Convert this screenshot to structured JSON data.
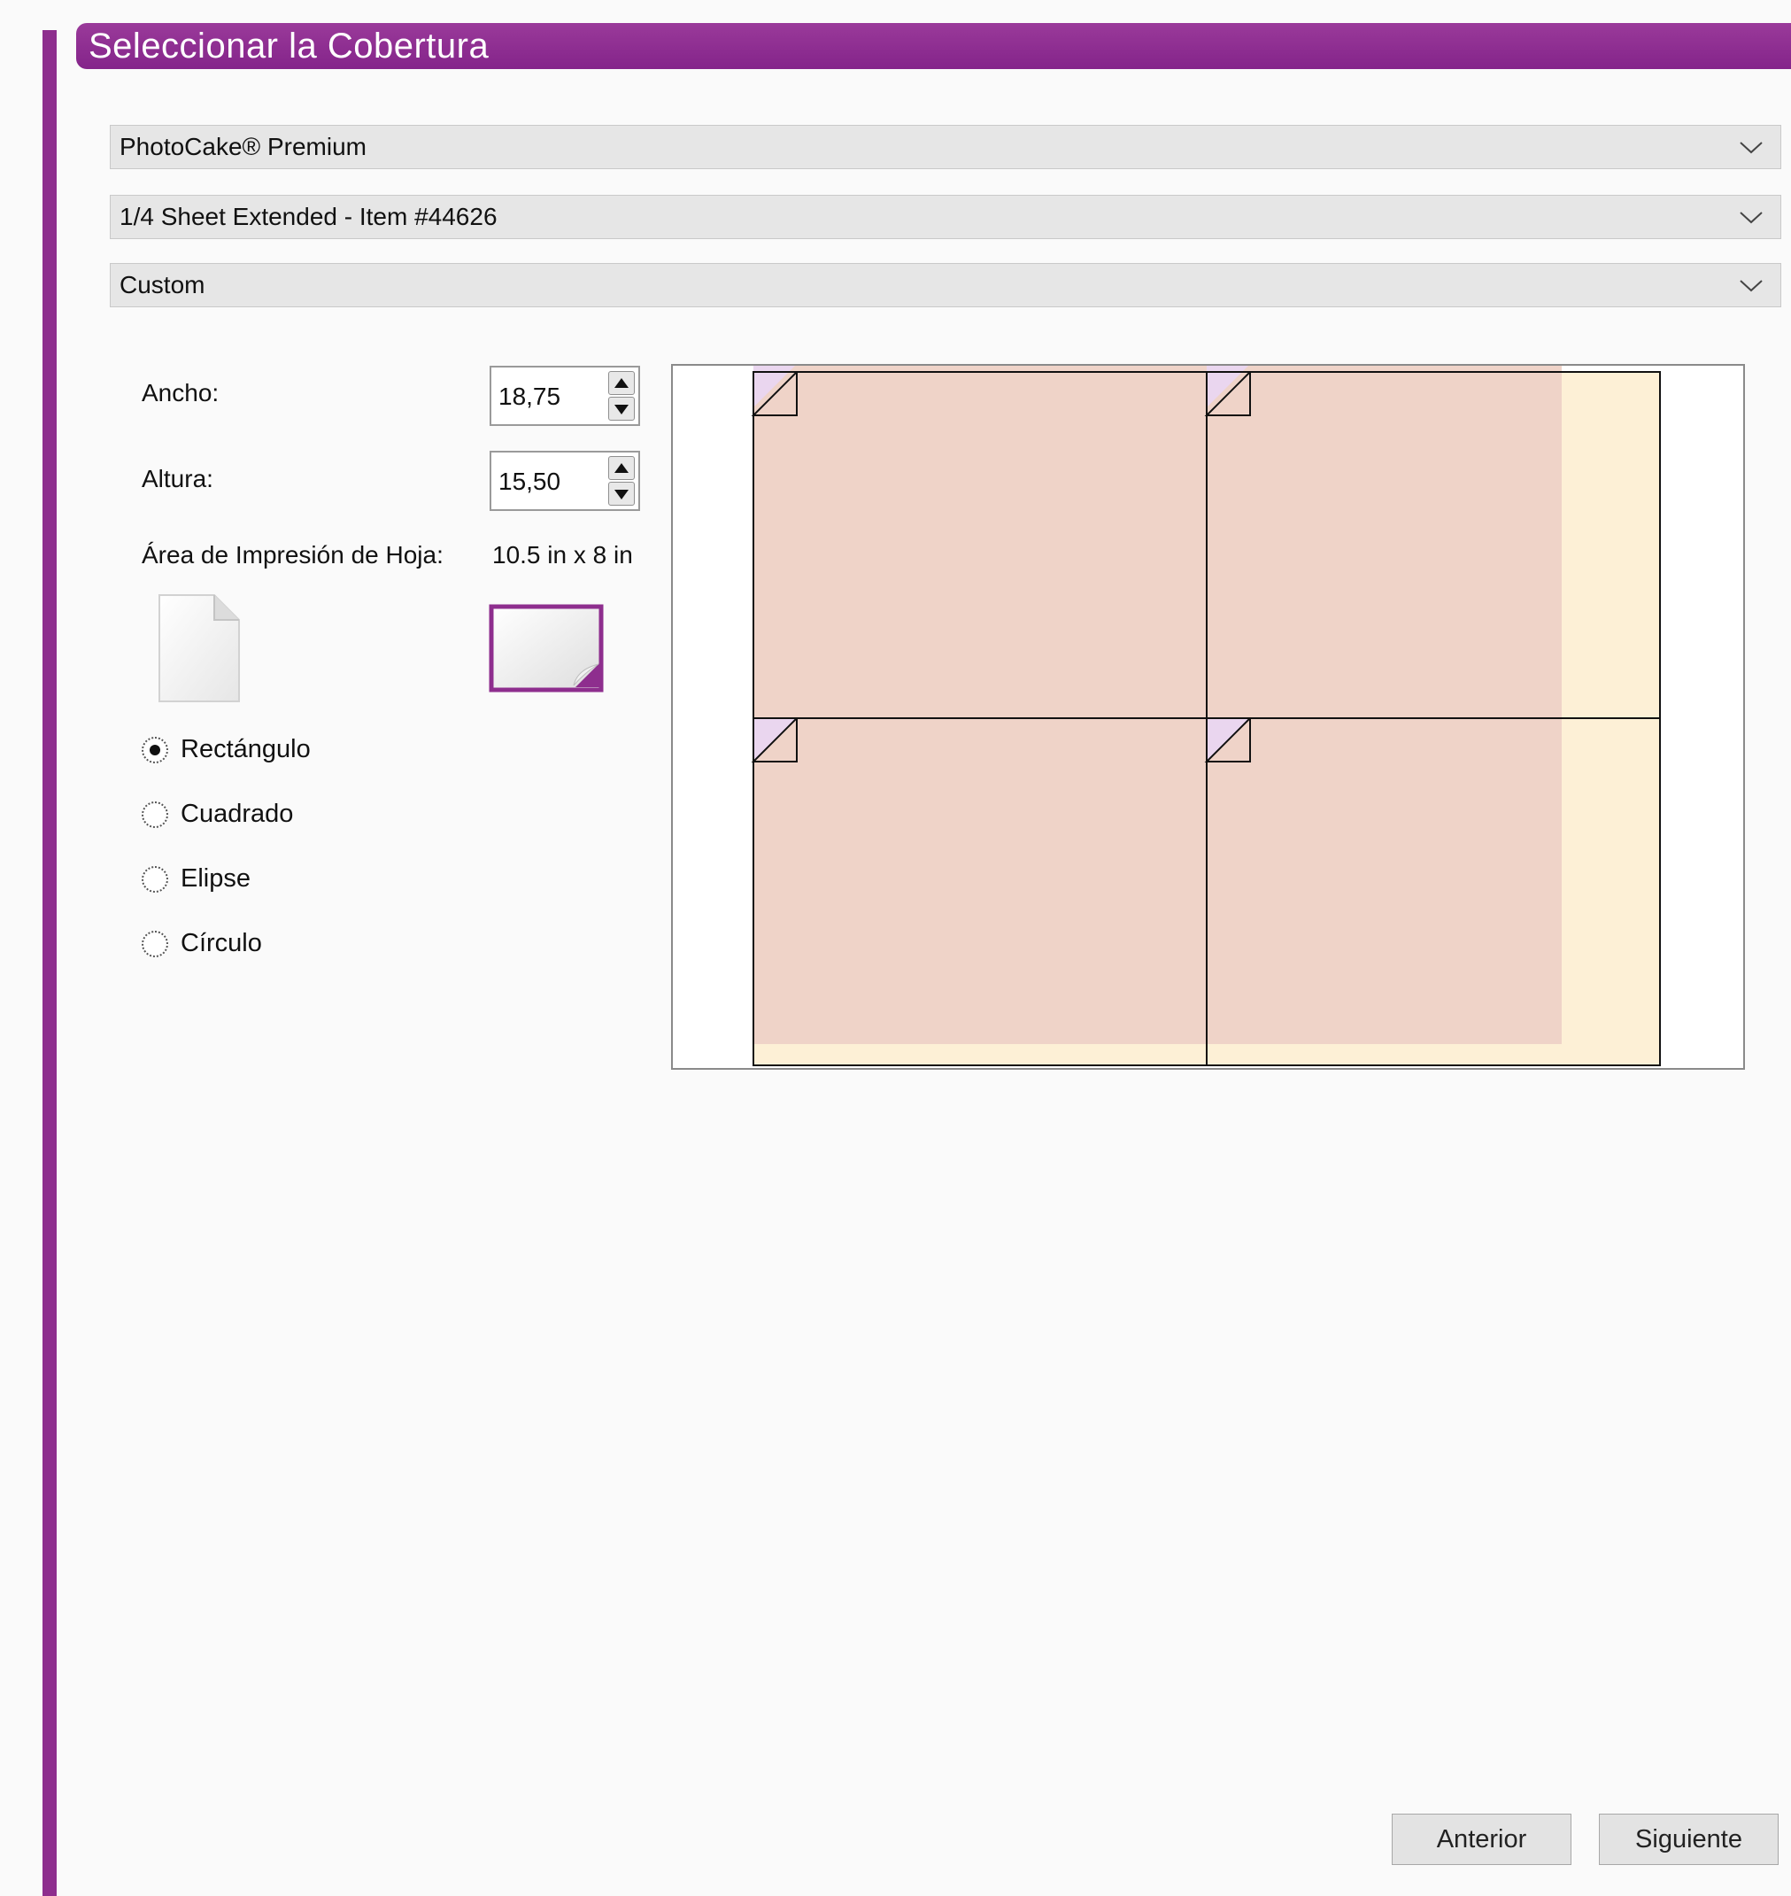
{
  "title": "Seleccionar la Cobertura",
  "dropdowns": {
    "media": "PhotoCake® Premium",
    "sheet": "1/4 Sheet Extended - Item #44626",
    "template": "Custom"
  },
  "form": {
    "width_label": "Ancho:",
    "width_value": "18,75",
    "height_label": "Altura:",
    "height_value": "15,50",
    "print_area_label": "Área de Impresión de Hoja:",
    "print_area_value": "10.5 in x 8 in"
  },
  "shapes": [
    {
      "label": "Rectángulo",
      "selected": true
    },
    {
      "label": "Cuadrado",
      "selected": false
    },
    {
      "label": "Elipse",
      "selected": false
    },
    {
      "label": "Círculo",
      "selected": false
    }
  ],
  "buttons": {
    "previous": "Anterior",
    "next": "Siguiente"
  },
  "colors": {
    "accent": "#8e2e8e",
    "cover_fill": "#efd3c8",
    "sheet_fill": "#fdf0d6"
  }
}
